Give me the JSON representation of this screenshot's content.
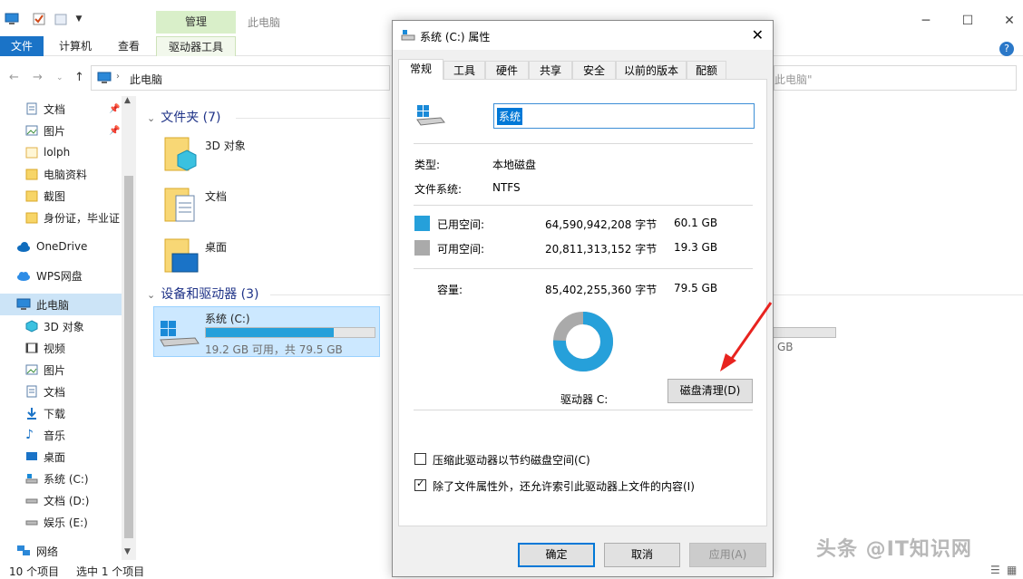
{
  "explorer": {
    "contextual_tab_group": "管理",
    "title": "此电脑",
    "ribbon_tabs": [
      "文件",
      "计算机",
      "查看",
      "驱动器工具"
    ],
    "address": "此电脑",
    "search_placeholder": "此电脑\"",
    "sidebar": [
      {
        "label": "文档",
        "icon": "document-icon",
        "pinned": true
      },
      {
        "label": "图片",
        "icon": "picture-icon",
        "pinned": true
      },
      {
        "label": "lolph",
        "icon": "folder-icon"
      },
      {
        "label": "电脑资料",
        "icon": "folder-icon"
      },
      {
        "label": "截图",
        "icon": "folder-icon"
      },
      {
        "label": "身份证，毕业证",
        "icon": "folder-icon"
      },
      {
        "label": "OneDrive",
        "icon": "cloud-icon"
      },
      {
        "label": "WPS网盘",
        "icon": "wps-cloud-icon"
      },
      {
        "label": "此电脑",
        "icon": "computer-icon",
        "selected": true
      },
      {
        "label": "3D 对象",
        "icon": "cube-icon"
      },
      {
        "label": "视频",
        "icon": "video-icon"
      },
      {
        "label": "图片",
        "icon": "picture-icon"
      },
      {
        "label": "文档",
        "icon": "document-icon"
      },
      {
        "label": "下载",
        "icon": "download-icon"
      },
      {
        "label": "音乐",
        "icon": "music-icon"
      },
      {
        "label": "桌面",
        "icon": "desktop-icon"
      },
      {
        "label": "系统 (C:)",
        "icon": "drive-icon"
      },
      {
        "label": "文档 (D:)",
        "icon": "drive-icon"
      },
      {
        "label": "娱乐 (E:)",
        "icon": "drive-icon"
      },
      {
        "label": "网络",
        "icon": "network-icon"
      }
    ],
    "folders_header": "文件夹 (7)",
    "folders": [
      "3D 对象",
      "文档",
      "桌面"
    ],
    "devices_header": "设备和驱动器 (3)",
    "drive": {
      "name": "系统 (C:)",
      "free_text": "19.2 GB 可用，共 79.5 GB",
      "used_fraction": 0.76
    },
    "hidden_drive_text": "GB",
    "status": {
      "count": "10 个项目",
      "selected": "选中 1 个项目"
    }
  },
  "dialog": {
    "title": "系统 (C:) 属性",
    "tabs": [
      "常规",
      "工具",
      "硬件",
      "共享",
      "安全",
      "以前的版本",
      "配额"
    ],
    "name_value": "系统",
    "type_label": "类型:",
    "type_value": "本地磁盘",
    "fs_label": "文件系统:",
    "fs_value": "NTFS",
    "used_label": "已用空间:",
    "used_bytes": "64,590,942,208 字节",
    "used_gb": "60.1 GB",
    "free_label": "可用空间:",
    "free_bytes": "20,811,313,152 字节",
    "free_gb": "19.3 GB",
    "cap_label": "容量:",
    "cap_bytes": "85,402,255,360 字节",
    "cap_gb": "79.5 GB",
    "used_color": "#26a0da",
    "free_color": "#aaaaaa",
    "used_fraction": 0.756,
    "drive_label": "驱动器 C:",
    "cleanup_button": "磁盘清理(D)",
    "compress_label": "压缩此驱动器以节约磁盘空间(C)",
    "compress_checked": false,
    "index_label": "除了文件属性外，还允许索引此驱动器上文件的内容(I)",
    "index_checked": true,
    "ok": "确定",
    "cancel": "取消",
    "apply": "应用(A)"
  },
  "watermark": "头条 @IT知识网"
}
